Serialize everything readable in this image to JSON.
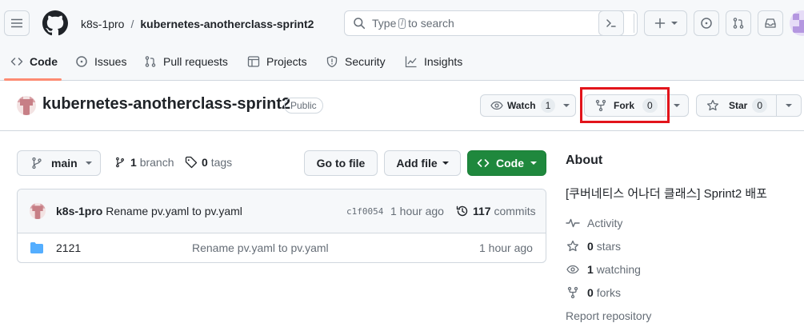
{
  "header": {
    "owner": "k8s-1pro",
    "separator": "/",
    "repo": "kubernetes-anotherclass-sprint2",
    "search_prefix": "Type",
    "search_key": "/",
    "search_suffix": "to search",
    "tabs": [
      {
        "label": "Code",
        "icon": "code-icon",
        "active": true
      },
      {
        "label": "Issues",
        "icon": "issue-icon"
      },
      {
        "label": "Pull requests",
        "icon": "pull-request-icon"
      },
      {
        "label": "Projects",
        "icon": "table-icon"
      },
      {
        "label": "Security",
        "icon": "shield-icon"
      },
      {
        "label": "Insights",
        "icon": "graph-icon"
      }
    ]
  },
  "repo": {
    "name": "kubernetes-anotherclass-sprint2",
    "visibility": "Public",
    "watch_label": "Watch",
    "watch_count": "1",
    "fork_label": "Fork",
    "fork_count": "0",
    "star_label": "Star",
    "star_count": "0"
  },
  "toolbar": {
    "branch": "main",
    "branches_count": "1",
    "branches_label": "branch",
    "tags_count": "0",
    "tags_label": "tags",
    "go_to_file": "Go to file",
    "add_file": "Add file",
    "code_button": "Code"
  },
  "commit": {
    "author": "k8s-1pro",
    "message": "Rename pv.yaml to pv.yaml",
    "sha": "c1f0054",
    "time": "1 hour ago",
    "commits_count": "117",
    "commits_label": "commits"
  },
  "files": [
    {
      "name": "2121",
      "message": "Rename pv.yaml to pv.yaml",
      "time": "1 hour ago"
    }
  ],
  "about": {
    "heading": "About",
    "description": "[쿠버네티스 어나더 클래스] Sprint2 배포",
    "activity": "Activity",
    "stars_count": "0",
    "stars_label": "stars",
    "watching_count": "1",
    "watching_label": "watching",
    "forks_count": "0",
    "forks_label": "forks",
    "report": "Report repository"
  },
  "colors": {
    "accent_green": "#1f883d",
    "tab_underline": "#fd8c73",
    "highlight_red": "#e2141b",
    "folder_blue": "#54aeff"
  }
}
